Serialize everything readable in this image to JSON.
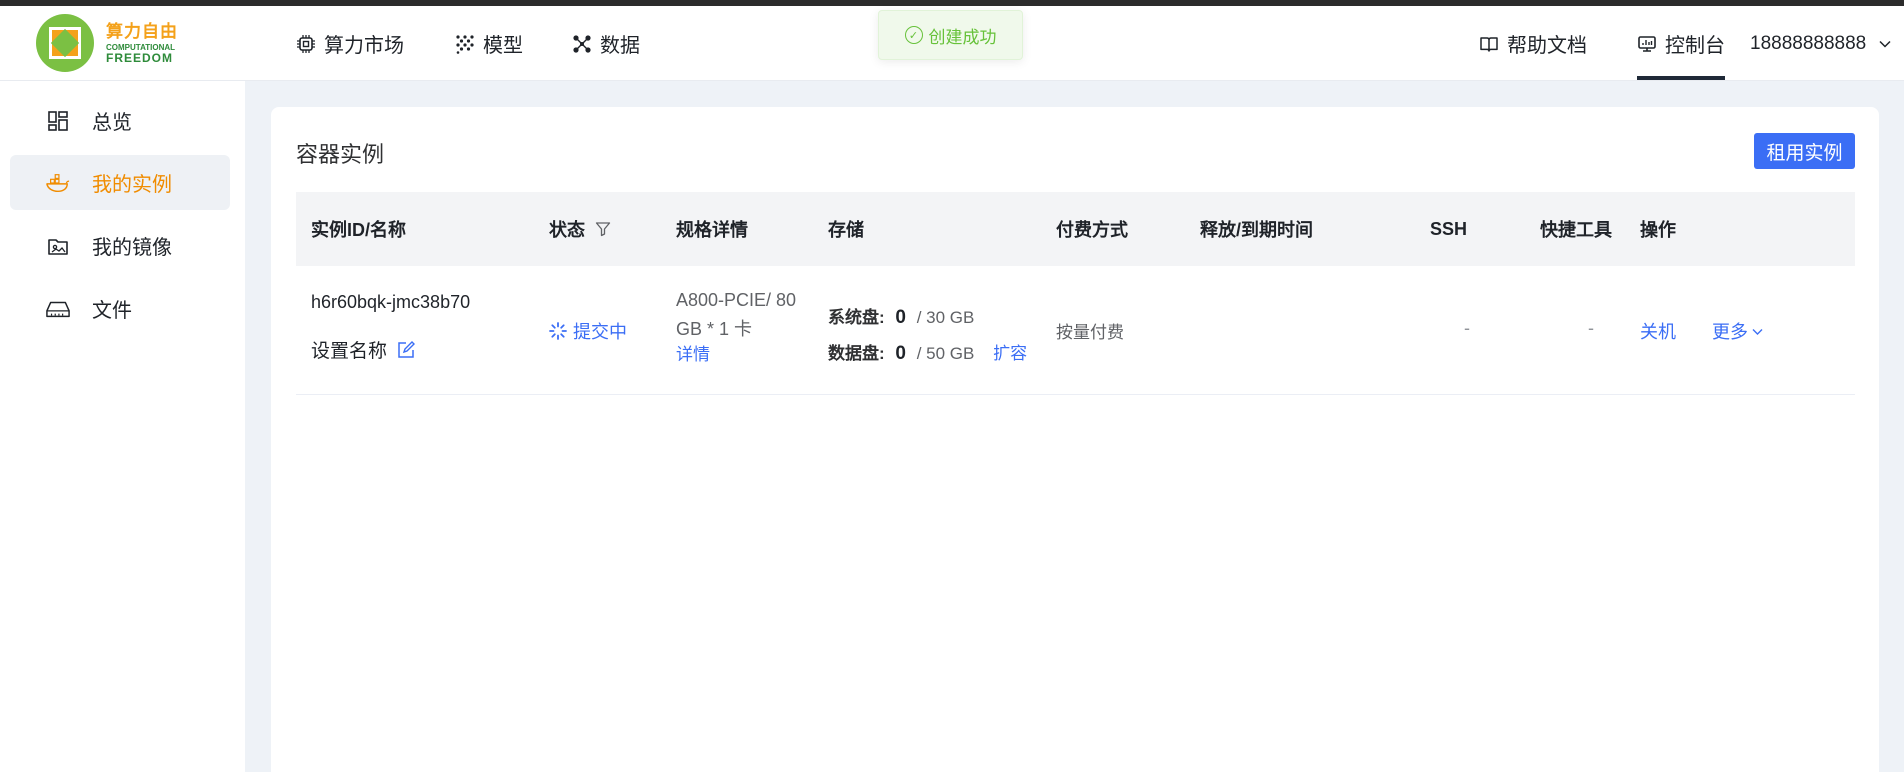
{
  "brand": {
    "name_cn": "算力自由",
    "name_en_line1": "COMPUTATIONAL",
    "name_en_line2": "FREEDOM",
    "colors": {
      "orange": "#f4a11a",
      "green": "#7bc043"
    }
  },
  "nav": {
    "items": [
      {
        "label": "算力市场",
        "icon": "chip-icon"
      },
      {
        "label": "模型",
        "icon": "model-grid-icon"
      },
      {
        "label": "数据",
        "icon": "data-nodes-icon"
      }
    ],
    "help": {
      "label": "帮助文档",
      "icon": "book-icon"
    },
    "console": {
      "label": "控制台",
      "icon": "monitor-icon"
    },
    "user": "18888888888"
  },
  "toast": {
    "message": "创建成功",
    "color": "#67c23a"
  },
  "sidebar": {
    "items": [
      {
        "label": "总览",
        "icon": "dashboard-icon"
      },
      {
        "label": "我的实例",
        "icon": "container-icon",
        "active": true
      },
      {
        "label": "我的镜像",
        "icon": "image-folder-icon"
      },
      {
        "label": "文件",
        "icon": "disk-icon"
      }
    ]
  },
  "main": {
    "title": "容器实例",
    "rent_button": "租用实例",
    "columns": [
      "实例ID/名称",
      "状态",
      "规格详情",
      "存储",
      "付费方式",
      "释放/到期时间",
      "SSH",
      "快捷工具",
      "操作"
    ],
    "row": {
      "instance_id": "h6r60bqk-jmc38b70",
      "set_name": "设置名称",
      "status": "提交中",
      "spec_line1": "A800-PCIE/ 80",
      "spec_line2": "GB * 1 卡",
      "spec_detail": "详情",
      "sys_disk_label": "系统盘:",
      "sys_disk_used": "0",
      "sys_disk_total": "/ 30 GB",
      "data_disk_label": "数据盘:",
      "data_disk_used": "0",
      "data_disk_total": "/ 50 GB",
      "expand": "扩容",
      "billing": "按量付费",
      "release_time": "",
      "ssh": "-",
      "tools": "-",
      "action_shutdown": "关机",
      "action_more": "更多"
    }
  },
  "accent": "#3b6ef5"
}
